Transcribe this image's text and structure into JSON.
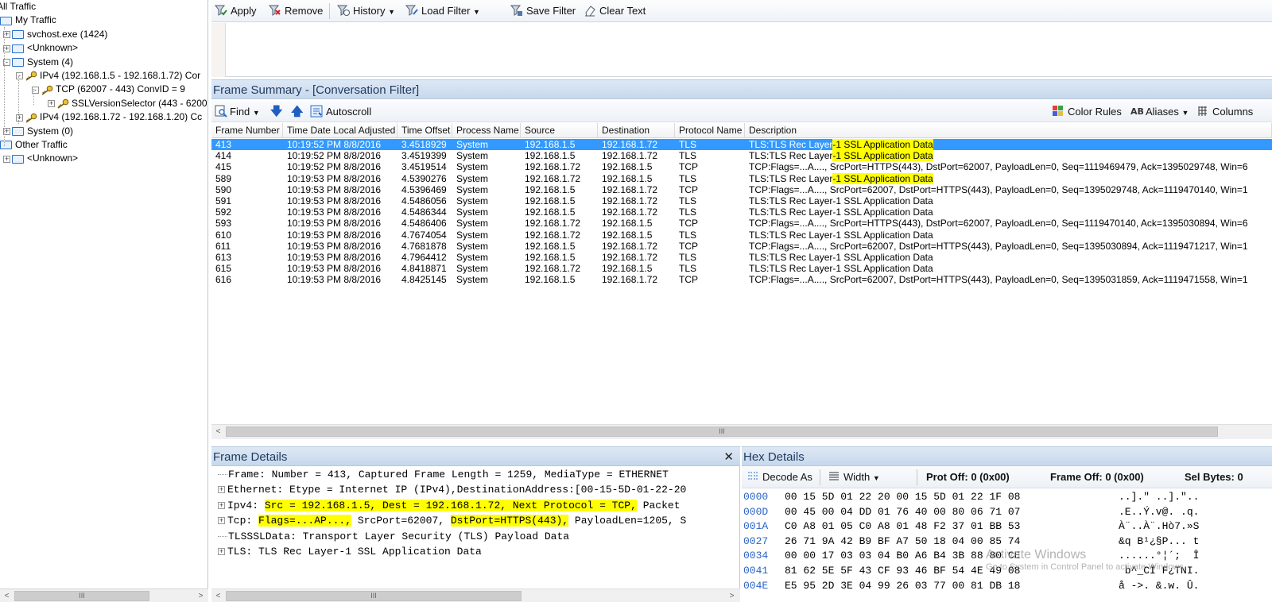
{
  "tree": {
    "items": [
      {
        "label": "All Traffic",
        "indent": 0,
        "icon": "none",
        "expander": ""
      },
      {
        "label": "My Traffic",
        "indent": 1,
        "icon": "monitor-icon",
        "expander": ""
      },
      {
        "label": "svchost.exe (1424)",
        "indent": 2,
        "icon": "monitor-icon",
        "expander": "+"
      },
      {
        "label": "<Unknown>",
        "indent": 2,
        "icon": "monitor-icon",
        "expander": "+"
      },
      {
        "label": "System (4)",
        "indent": 2,
        "icon": "monitor-icon",
        "expander": "-"
      },
      {
        "label": "IPv4 (192.168.1.5 - 192.168.1.72) Cor",
        "indent": 3,
        "icon": "key-icon",
        "expander": "-"
      },
      {
        "label": "TCP (62007 - 443) ConvID = 9",
        "indent": 4,
        "icon": "key-icon",
        "expander": "-"
      },
      {
        "label": "SSLVersionSelector (443 - 6200",
        "indent": 5,
        "icon": "key-icon",
        "expander": "+"
      },
      {
        "label": "IPv4 (192.168.1.72 - 192.168.1.20) Cc",
        "indent": 3,
        "icon": "key-icon",
        "expander": "+"
      },
      {
        "label": "System (0)",
        "indent": 2,
        "icon": "monitor-icon",
        "expander": "+"
      },
      {
        "label": "Other Traffic",
        "indent": 1,
        "icon": "monitor-icon",
        "expander": ""
      },
      {
        "label": "<Unknown>",
        "indent": 2,
        "icon": "monitor-icon",
        "expander": "+"
      }
    ],
    "scroll_label": "III"
  },
  "filter_toolbar": {
    "apply": "Apply",
    "remove": "Remove",
    "history": "History",
    "load_filter": "Load Filter",
    "save_filter": "Save Filter",
    "clear_text": "Clear Text",
    "filter_text": ""
  },
  "frame_summary": {
    "title": "Frame Summary - [Conversation Filter]",
    "toolbar": {
      "find": "Find",
      "autoscroll": "Autoscroll",
      "color_rules": "Color Rules",
      "aliases": "Aliases",
      "columns": "Columns"
    },
    "columns": [
      "Frame Number",
      "Time Date Local Adjusted",
      "Time Offset",
      "Process Name",
      "Source",
      "Destination",
      "Protocol Name",
      "Description"
    ],
    "rows": [
      {
        "num": "413",
        "time": "10:19:52 PM 8/8/2016",
        "offset": "3.4518929",
        "process": "System",
        "src": "192.168.1.5",
        "dst": "192.168.1.72",
        "proto": "TLS",
        "desc": "TLS:TLS Rec Layer",
        "desc_hl": "-1 SSL Application Data",
        "desc_tail": "",
        "selected": true
      },
      {
        "num": "414",
        "time": "10:19:52 PM 8/8/2016",
        "offset": "3.4519399",
        "process": "System",
        "src": "192.168.1.5",
        "dst": "192.168.1.72",
        "proto": "TLS",
        "desc": "TLS:TLS Rec Layer",
        "desc_hl": "-1 SSL Application Data",
        "desc_tail": "",
        "selected": false
      },
      {
        "num": "415",
        "time": "10:19:52 PM 8/8/2016",
        "offset": "3.4519514",
        "process": "System",
        "src": "192.168.1.72",
        "dst": "192.168.1.5",
        "proto": "TCP",
        "desc": "TCP:Flags=...A...., SrcPort=HTTPS(443), DstPort=62007, PayloadLen=0, Seq=1119469479, Ack=1395029748, Win=6",
        "desc_hl": "",
        "desc_tail": "",
        "selected": false
      },
      {
        "num": "589",
        "time": "10:19:53 PM 8/8/2016",
        "offset": "4.5390276",
        "process": "System",
        "src": "192.168.1.72",
        "dst": "192.168.1.5",
        "proto": "TLS",
        "desc": "TLS:TLS Rec Layer",
        "desc_hl": "-1 SSL Application Data",
        "desc_tail": "",
        "selected": false
      },
      {
        "num": "590",
        "time": "10:19:53 PM 8/8/2016",
        "offset": "4.5396469",
        "process": "System",
        "src": "192.168.1.5",
        "dst": "192.168.1.72",
        "proto": "TCP",
        "desc": "TCP:Flags=...A...., SrcPort=62007, DstPort=HTTPS(443), PayloadLen=0, Seq=1395029748, Ack=1119470140, Win=1",
        "desc_hl": "",
        "desc_tail": "",
        "selected": false
      },
      {
        "num": "591",
        "time": "10:19:53 PM 8/8/2016",
        "offset": "4.5486056",
        "process": "System",
        "src": "192.168.1.5",
        "dst": "192.168.1.72",
        "proto": "TLS",
        "desc": "TLS:TLS Rec Layer-1 SSL Application Data",
        "desc_hl": "",
        "desc_tail": "",
        "selected": false
      },
      {
        "num": "592",
        "time": "10:19:53 PM 8/8/2016",
        "offset": "4.5486344",
        "process": "System",
        "src": "192.168.1.5",
        "dst": "192.168.1.72",
        "proto": "TLS",
        "desc": "TLS:TLS Rec Layer-1 SSL Application Data",
        "desc_hl": "",
        "desc_tail": "",
        "selected": false
      },
      {
        "num": "593",
        "time": "10:19:53 PM 8/8/2016",
        "offset": "4.5486406",
        "process": "System",
        "src": "192.168.1.72",
        "dst": "192.168.1.5",
        "proto": "TCP",
        "desc": "TCP:Flags=...A...., SrcPort=HTTPS(443), DstPort=62007, PayloadLen=0, Seq=1119470140, Ack=1395030894, Win=6",
        "desc_hl": "",
        "desc_tail": "",
        "selected": false
      },
      {
        "num": "610",
        "time": "10:19:53 PM 8/8/2016",
        "offset": "4.7674054",
        "process": "System",
        "src": "192.168.1.72",
        "dst": "192.168.1.5",
        "proto": "TLS",
        "desc": "TLS:TLS Rec Layer-1 SSL Application Data",
        "desc_hl": "",
        "desc_tail": "",
        "selected": false
      },
      {
        "num": "611",
        "time": "10:19:53 PM 8/8/2016",
        "offset": "4.7681878",
        "process": "System",
        "src": "192.168.1.5",
        "dst": "192.168.1.72",
        "proto": "TCP",
        "desc": "TCP:Flags=...A...., SrcPort=62007, DstPort=HTTPS(443), PayloadLen=0, Seq=1395030894, Ack=1119471217, Win=1",
        "desc_hl": "",
        "desc_tail": "",
        "selected": false
      },
      {
        "num": "613",
        "time": "10:19:53 PM 8/8/2016",
        "offset": "4.7964412",
        "process": "System",
        "src": "192.168.1.5",
        "dst": "192.168.1.72",
        "proto": "TLS",
        "desc": "TLS:TLS Rec Layer-1 SSL Application Data",
        "desc_hl": "",
        "desc_tail": "",
        "selected": false
      },
      {
        "num": "615",
        "time": "10:19:53 PM 8/8/2016",
        "offset": "4.8418871",
        "process": "System",
        "src": "192.168.1.72",
        "dst": "192.168.1.5",
        "proto": "TLS",
        "desc": "TLS:TLS Rec Layer-1 SSL Application Data",
        "desc_hl": "",
        "desc_tail": "",
        "selected": false
      },
      {
        "num": "616",
        "time": "10:19:53 PM 8/8/2016",
        "offset": "4.8425145",
        "process": "System",
        "src": "192.168.1.5",
        "dst": "192.168.1.72",
        "proto": "TCP",
        "desc": "TCP:Flags=...A...., SrcPort=62007, DstPort=HTTPS(443), PayloadLen=0, Seq=1395031859, Ack=1119471558, Win=1",
        "desc_hl": "",
        "desc_tail": "",
        "selected": false
      }
    ],
    "scroll_label": "III"
  },
  "frame_details": {
    "title": "Frame Details",
    "close_glyph": "✕",
    "rows": [
      {
        "expander": "",
        "pre": "Frame: Number = 413, Captured Frame Length = 1259, MediaType = ETHERNET",
        "hl": "",
        "mid": "",
        "hl2": "",
        "post": ""
      },
      {
        "expander": "+",
        "pre": "Ethernet: Etype = Internet IP (IPv4),DestinationAddress:[00-15-5D-01-22-20",
        "hl": "",
        "mid": "",
        "hl2": "",
        "post": ""
      },
      {
        "expander": "+",
        "pre": "Ipv4: ",
        "hl": "Src = 192.168.1.5, Dest = 192.168.1.72, Next Protocol = TCP,",
        "mid": " Packet",
        "hl2": "",
        "post": ""
      },
      {
        "expander": "+",
        "pre": "Tcp: ",
        "hl": "Flags=...AP...,",
        "mid": " SrcPort=62007, ",
        "hl2": "DstPort=HTTPS(443),",
        "post": " PayloadLen=1205, S"
      },
      {
        "expander": "",
        "pre": "TLSSSLData: Transport Layer Security (TLS) Payload Data",
        "hl": "",
        "mid": "",
        "hl2": "",
        "post": ""
      },
      {
        "expander": "+",
        "pre": "TLS: TLS Rec Layer-1 SSL Application Data",
        "hl": "",
        "mid": "",
        "hl2": "",
        "post": ""
      }
    ],
    "scroll_label": "III"
  },
  "hex_details": {
    "title": "Hex Details",
    "toolbar": {
      "decode_as": "Decode As",
      "width": "Width",
      "prot_off": "Prot Off: 0 (0x00)",
      "frame_off": "Frame Off: 0 (0x00)",
      "sel_bytes": "Sel Bytes: 0"
    },
    "rows": [
      {
        "off": "0000",
        "bytes": "00 15 5D 01 22 20 00 15 5D 01 22 1F 08",
        "ascii": "..].\" ..].\".."
      },
      {
        "off": "000D",
        "bytes": "00 45 00 04 DD 01 76 40 00 80 06 71 07",
        "ascii": ".E..Ý.v@. .q."
      },
      {
        "off": "001A",
        "bytes": "C0 A8 01 05 C0 A8 01 48 F2 37 01 BB 53",
        "ascii": "À¨..À¨.Hò7.»S"
      },
      {
        "off": "0027",
        "bytes": "26 71 9A 42 B9 BF A7 50 18 04 00 85 74",
        "ascii": "&q B¹¿§P... t"
      },
      {
        "off": "0034",
        "bytes": "00 00 17 03 03 04 B0 A6 B4 3B 88 80 CE",
        "ascii": "......°¦´;  Î"
      },
      {
        "off": "0041",
        "bytes": "81 62 5E 5F 43 CF 93 46 BF 54 4E 49 08",
        "ascii": " b^_CÏ F¿TNI."
      },
      {
        "off": "004E",
        "bytes": "E5 95 2D 3E 04 99 26 03 77 00 81 DB 18",
        "ascii": "å ->. &.w. Û."
      }
    ]
  },
  "watermark": {
    "line1": "Activate Windows",
    "line2": "Go to System in Control Panel to activate Windows."
  },
  "colors": {
    "selection": "#3399ff",
    "highlight": "#ffff00",
    "header_text": "#1e3a5f"
  }
}
